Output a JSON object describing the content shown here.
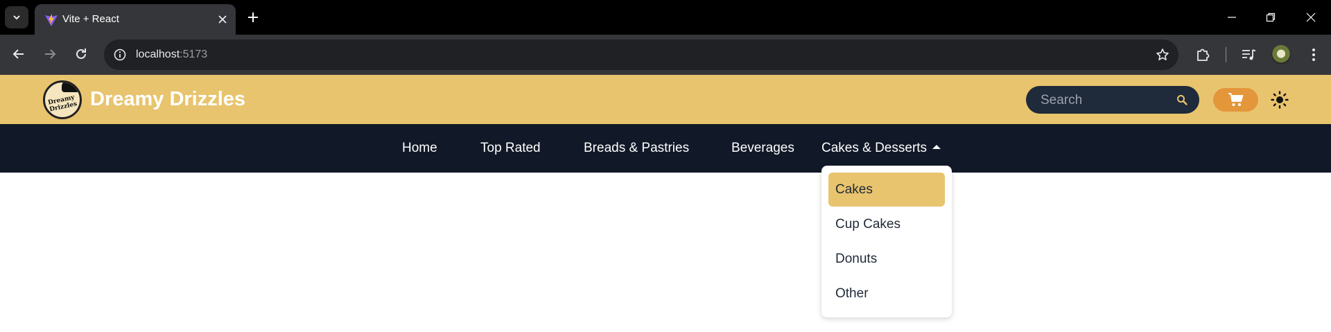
{
  "browser": {
    "tab_title": "Vite + React",
    "url_host": "localhost",
    "url_port": ":5173"
  },
  "header": {
    "logo_text": "Dreamy Drizzles",
    "brand": "Dreamy Drizzles",
    "search_placeholder": "Search"
  },
  "nav": {
    "items": [
      "Home",
      "Top Rated",
      "Breads & Pastries",
      "Beverages",
      "Cakes & Desserts"
    ]
  },
  "dropdown": {
    "items": [
      "Cakes",
      "Cup Cakes",
      "Donuts",
      "Other"
    ],
    "highlighted": "Cakes"
  },
  "colors": {
    "header_bg": "#e8c46e",
    "nav_bg": "#111827",
    "cart_bg": "#e4963a",
    "search_bg": "#1f2a3a"
  }
}
